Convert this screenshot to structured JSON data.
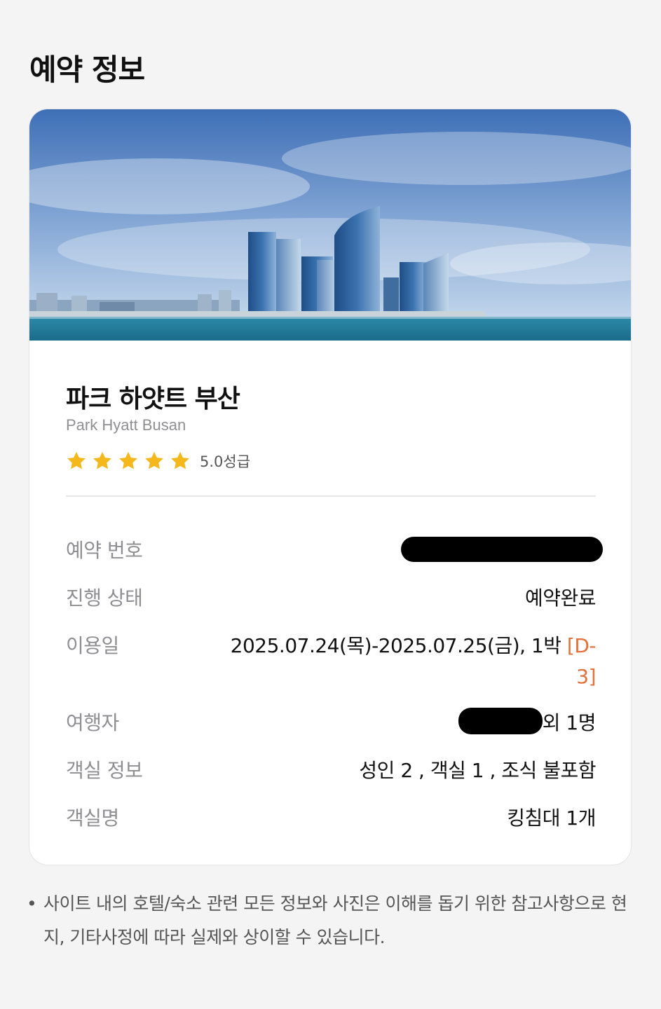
{
  "page": {
    "title": "예약 정보"
  },
  "hotel": {
    "name_ko": "파크 하얏트 부산",
    "name_en": "Park Hyatt Busan",
    "stars": 5,
    "rating_label": "5.0성급",
    "star_color": "#f5b81c"
  },
  "details": {
    "reservation_number": {
      "label": "예약 번호",
      "value": ""
    },
    "status": {
      "label": "진행 상태",
      "value": "예약완료"
    },
    "dates": {
      "label": "이용일",
      "value": "2025.07.24(목)-2025.07.25(금), 1박",
      "dday_line1": "[D-",
      "dday_line2": "3]"
    },
    "traveler": {
      "label": "여행자",
      "value_suffix": "외 1명"
    },
    "room_info": {
      "label": "객실 정보",
      "value": "성인 2 , 객실 1 , 조식 불포함"
    },
    "room_name": {
      "label": "객실명",
      "value": "킹침대 1개"
    }
  },
  "notice": {
    "bullet": "•",
    "text": "사이트 내의 호텔/숙소 관련 모든 정보와 사진은 이해를 돕기 위한 참고사항으로 현지, 기타사정에 따라 실제와 상이할 수 있습니다."
  },
  "colors": {
    "accent_dday": "#e6703a",
    "label_gray": "#8e8e93"
  }
}
